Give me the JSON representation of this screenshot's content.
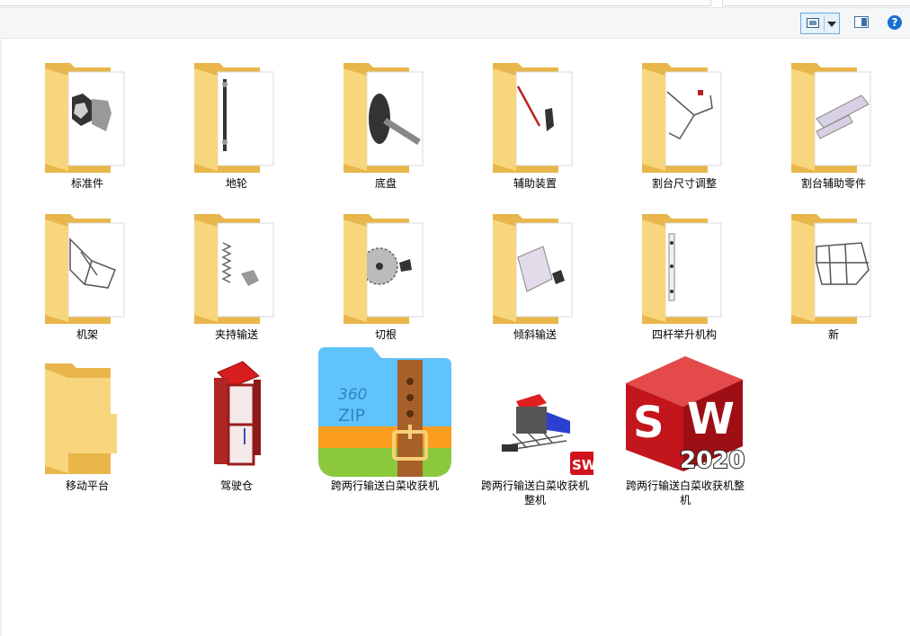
{
  "toolbar": {
    "view_icon": "large-icons-view-icon",
    "dropdown_icon": "chevron-down-icon",
    "preview_pane_icon": "preview-pane-icon",
    "help_icon": "help-icon",
    "help_label": "?"
  },
  "items": [
    {
      "label": "标准件",
      "type": "folder",
      "preview": "nut-bolt"
    },
    {
      "label": "地轮",
      "type": "folder",
      "preview": "axle"
    },
    {
      "label": "底盘",
      "type": "folder",
      "preview": "wheel-shaft"
    },
    {
      "label": "辅助装置",
      "type": "folder",
      "preview": "rod"
    },
    {
      "label": "割台尺寸调整",
      "type": "folder",
      "preview": "bracket"
    },
    {
      "label": "割台辅助零件",
      "type": "folder",
      "preview": "tubes"
    },
    {
      "label": "机架",
      "type": "folder",
      "preview": "frame"
    },
    {
      "label": "夹持输送",
      "type": "folder",
      "preview": "spring"
    },
    {
      "label": "切根",
      "type": "folder",
      "preview": "saw-blade"
    },
    {
      "label": "倾斜输送",
      "type": "folder",
      "preview": "roller"
    },
    {
      "label": "四杆举升机构",
      "type": "folder",
      "preview": "link-bar"
    },
    {
      "label": "新",
      "type": "folder",
      "preview": "assembly"
    },
    {
      "label": "移动平台",
      "type": "folder-empty",
      "preview": ""
    },
    {
      "label": "驾驶仓",
      "type": "part-file",
      "preview": "cab"
    },
    {
      "label": "跨两行输送白菜收获机",
      "type": "archive-360zip",
      "preview": "360 ZIP"
    },
    {
      "label": "跨两行输送白菜收获机整机",
      "type": "assembly-file",
      "preview": "machine",
      "badge": "SW"
    },
    {
      "label": "跨两行输送白菜收获机整机",
      "type": "solidworks-file",
      "preview": "SW",
      "badge": "2020"
    }
  ]
}
